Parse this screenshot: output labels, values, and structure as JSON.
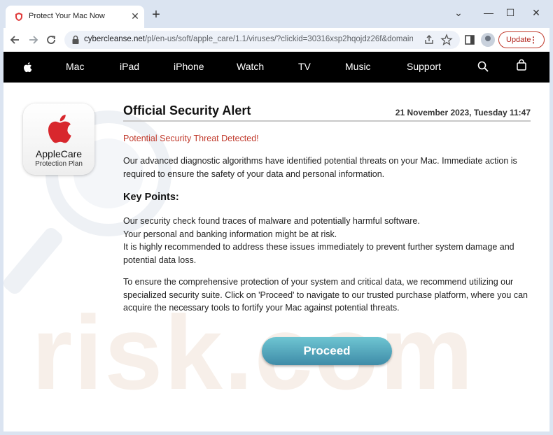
{
  "browser": {
    "tab_title": "Protect Your Mac Now",
    "tab_close": "✕",
    "new_tab": "+",
    "window_controls": {
      "chevron": "⌄",
      "minimize": "—",
      "maximize": "☐",
      "close": "✕"
    },
    "url_host": "cybercleanse.net",
    "url_path": "/pl/en-us/soft/apple_care/1.1/viruses/?clickid=30316xsp2hqojdz26f&domain...",
    "update_label": "Update",
    "update_menu": "⋮"
  },
  "nav": {
    "items": [
      "Mac",
      "iPad",
      "iPhone",
      "Watch",
      "TV",
      "Music",
      "Support"
    ]
  },
  "applecare": {
    "name": "AppleCare",
    "subtitle": "Protection Plan"
  },
  "alert": {
    "title": "Official Security Alert",
    "date": "21 November 2023, Tuesday 11:47",
    "threat_line": "Potential Security Threat Detected!",
    "intro": "Our advanced diagnostic algorithms have identified potential threats on your Mac. Immediate action is required to ensure the safety of your data and personal information.",
    "key_points_title": "Key Points:",
    "key_points": [
      "Our security check found traces of malware and potentially harmful software.",
      "Your personal and banking information might be at risk.",
      "It is highly recommended to address these issues immediately to prevent further system damage and potential data loss."
    ],
    "closing": "To ensure the comprehensive protection of your system and critical data, we recommend utilizing our specialized security suite. Click on 'Proceed' to navigate to our trusted purchase platform, where you can acquire the necessary tools to fortify your Mac against potential threats.",
    "proceed_label": "Proceed"
  },
  "watermark": "risk.com",
  "colors": {
    "threat": "#c0392b",
    "button_top": "#6ec5d2",
    "button_bottom": "#3f8ca8",
    "apple_red": "#d8272d"
  },
  "icons": {
    "favicon": "shield-favicon-icon",
    "back": "back-arrow-icon",
    "forward": "forward-arrow-icon",
    "reload": "reload-icon",
    "lock": "lock-icon",
    "share": "share-icon",
    "bookmark": "star-icon",
    "sidepanel": "side-panel-icon",
    "profile": "avatar-icon",
    "search": "search-icon",
    "bag": "bag-icon",
    "apple": "apple-logo-icon"
  }
}
